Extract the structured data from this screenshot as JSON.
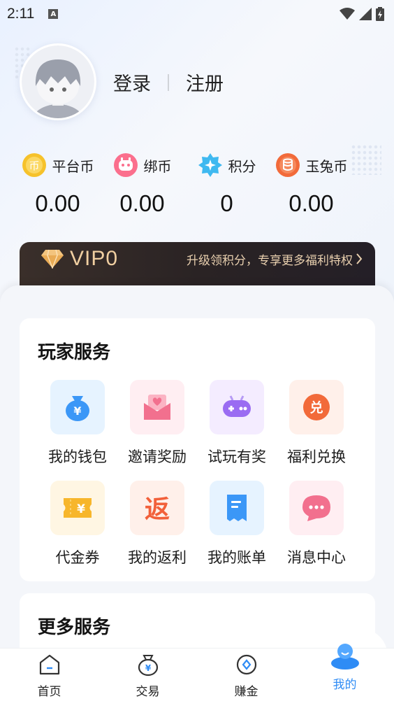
{
  "status_bar": {
    "time": "2:11",
    "notification_badge": "A"
  },
  "auth": {
    "login": "登录",
    "register": "注册"
  },
  "balances": [
    {
      "label": "平台币",
      "value": "0.00",
      "icon": "platform-coin-icon",
      "color": "#f6c22b",
      "glyph": "币"
    },
    {
      "label": "绑币",
      "value": "0.00",
      "icon": "bound-coin-icon",
      "color": "#fb6f8d",
      "glyph": ""
    },
    {
      "label": "积分",
      "value": "0",
      "icon": "points-icon",
      "color": "#3fb9f0",
      "glyph": ""
    },
    {
      "label": "玉兔币",
      "value": "0.00",
      "icon": "jade-rabbit-coin-icon",
      "color": "#f26a3a",
      "glyph": ""
    }
  ],
  "vip": {
    "level": "VIP0",
    "description": "升级领积分，专享更多福利特权"
  },
  "player_services": {
    "title": "玩家服务",
    "items": [
      {
        "label": "我的钱包",
        "icon": "wallet-icon",
        "bg": "#e6f3ff",
        "color": "#3b97f7"
      },
      {
        "label": "邀请奖励",
        "icon": "invite-envelope-icon",
        "bg": "#ffeef2",
        "color": "#f2708e"
      },
      {
        "label": "试玩有奖",
        "icon": "gamepad-icon",
        "bg": "#f4ecff",
        "color": "#9a6cf2"
      },
      {
        "label": "福利兑换",
        "icon": "exchange-icon",
        "bg": "#fff0ea",
        "color": "#f26a3a"
      },
      {
        "label": "代金券",
        "icon": "voucher-icon",
        "bg": "#fff6e3",
        "color": "#f7b62b"
      },
      {
        "label": "我的返利",
        "icon": "rebate-icon",
        "bg": "#fff0ea",
        "color": "#f2603a",
        "glyph": "返"
      },
      {
        "label": "我的账单",
        "icon": "bill-icon",
        "bg": "#e6f3ff",
        "color": "#3b97f7"
      },
      {
        "label": "消息中心",
        "icon": "message-icon",
        "bg": "#ffeef2",
        "color": "#f2708e"
      }
    ]
  },
  "more_services": {
    "title": "更多服务"
  },
  "tabbar": {
    "items": [
      {
        "label": "首页",
        "icon": "home-icon"
      },
      {
        "label": "交易",
        "icon": "trade-bag-icon"
      },
      {
        "label": "赚金",
        "icon": "earn-coin-icon"
      },
      {
        "label": "我的",
        "icon": "profile-icon"
      }
    ],
    "active_color": "#2f8cf5"
  }
}
